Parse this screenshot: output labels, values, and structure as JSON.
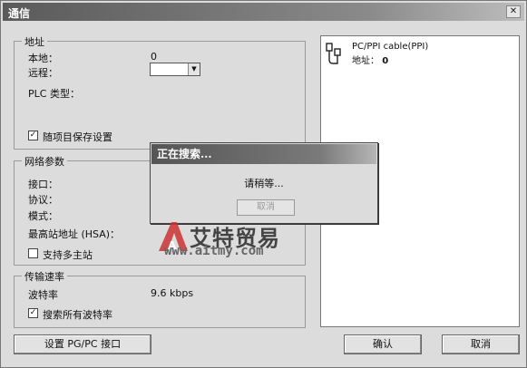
{
  "window": {
    "title": "通信",
    "close_glyph": "✕"
  },
  "address_group": {
    "title": "地址",
    "local_label": "本地：",
    "local_value": "0",
    "remote_label": "远程：",
    "remote_value": "",
    "plc_type_label": "PLC 类型：",
    "save_settings_label": "随项目保存设置",
    "save_settings_checked": true
  },
  "network_group": {
    "title": "网络参数",
    "interface_label": "接口：",
    "protocol_label": "协议：",
    "mode_label": "模式：",
    "hsa_label": "最高站地址 (HSA)：",
    "multi_master_label": "支持多主站",
    "multi_master_checked": false
  },
  "baud_group": {
    "title": "传输速率",
    "baud_label": "波特率",
    "baud_value": "9.6 kbps",
    "search_all_label": "搜索所有波特率",
    "search_all_checked": true
  },
  "device_panel": {
    "device_name": "PC/PPI cable(PPI)",
    "address_label": "地址：",
    "address_value": "0"
  },
  "buttons": {
    "set_interface": "设置 PG/PC 接口",
    "ok": "确认",
    "cancel": "取消"
  },
  "search_dialog": {
    "title": "正在搜索...",
    "message": "请稍等...",
    "cancel_label": "取消"
  },
  "watermark": {
    "logo_letter": "A",
    "brand_text": "艾特贸易",
    "url": "www.aitmy.com"
  }
}
